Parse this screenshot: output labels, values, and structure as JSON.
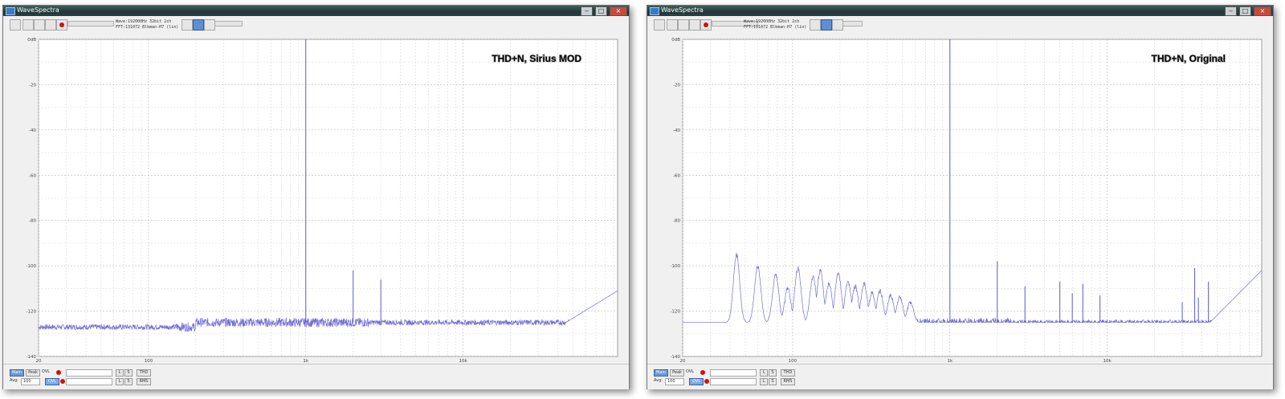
{
  "windows": [
    {
      "title": "WaveSpectra",
      "info_line1": "Wave:192000Hz 32bit 2ch",
      "info_line2": "FFT:131072 Blkman-H7 (lin)",
      "annotation": "THD+N, Sirius MOD",
      "y_ticks": [
        "0dB",
        "-20",
        "-40",
        "-60",
        "-80",
        "-100",
        "-120",
        "-140"
      ],
      "x_ticks": [
        "20",
        "100",
        "1k",
        "10k"
      ],
      "bottom": {
        "main": "Main",
        "peak": "Peak",
        "ovl_label": "OVL",
        "ovl_button": "OVL",
        "avg_label": "Avg:",
        "avg_value": "100",
        "l": "L",
        "s1": "S",
        "s2": "S",
        "thd": "THD",
        "rms": "RMS"
      },
      "spectrum": {
        "fundamental_hz": 1000,
        "fundamental_db": 0,
        "noise_floor_db": -125,
        "harmonics": [
          {
            "hz": 2000,
            "db": -102
          },
          {
            "hz": 3000,
            "db": -106
          }
        ],
        "hf_rise": {
          "from_hz": 45000,
          "to_db": -111
        },
        "hump_peaks": []
      }
    },
    {
      "title": "WaveSpectra",
      "info_line1": "Wave:192000Hz 32bit 2ch",
      "info_line2": "FFT:131072 Blkman-H7 (lin)",
      "annotation": "THD+N, Original",
      "y_ticks": [
        "0dB",
        "-20",
        "-40",
        "-60",
        "-80",
        "-100",
        "-120",
        "-140"
      ],
      "x_ticks": [
        "20",
        "100",
        "1k",
        "10k"
      ],
      "bottom": {
        "main": "Main",
        "peak": "Peak",
        "ovl_label": "OVL",
        "ovl_button": "OVL",
        "avg_label": "Avg:",
        "avg_value": "100",
        "l": "L",
        "s1": "S",
        "s2": "S",
        "thd": "THD",
        "rms": "RMS"
      },
      "spectrum": {
        "fundamental_hz": 1000,
        "fundamental_db": 0,
        "noise_floor_db": -125,
        "harmonics": [
          {
            "hz": 2000,
            "db": -98
          },
          {
            "hz": 3000,
            "db": -109
          },
          {
            "hz": 5000,
            "db": -107
          },
          {
            "hz": 6000,
            "db": -112
          },
          {
            "hz": 7000,
            "db": -108
          },
          {
            "hz": 9000,
            "db": -113
          },
          {
            "hz": 30000,
            "db": -116
          },
          {
            "hz": 36000,
            "db": -101
          },
          {
            "hz": 38000,
            "db": -114
          },
          {
            "hz": 44000,
            "db": -107
          }
        ],
        "hf_rise": {
          "from_hz": 45000,
          "to_db": -102
        },
        "hump_peaks": [
          {
            "hz": 44,
            "db": -95
          },
          {
            "hz": 60,
            "db": -100
          },
          {
            "hz": 78,
            "db": -104
          },
          {
            "hz": 93,
            "db": -110
          },
          {
            "hz": 108,
            "db": -101
          },
          {
            "hz": 135,
            "db": -105
          },
          {
            "hz": 150,
            "db": -102
          },
          {
            "hz": 170,
            "db": -108
          },
          {
            "hz": 195,
            "db": -103
          },
          {
            "hz": 225,
            "db": -107
          },
          {
            "hz": 250,
            "db": -109
          },
          {
            "hz": 285,
            "db": -108
          },
          {
            "hz": 320,
            "db": -112
          },
          {
            "hz": 360,
            "db": -111
          },
          {
            "hz": 420,
            "db": -113
          },
          {
            "hz": 480,
            "db": -114
          },
          {
            "hz": 560,
            "db": -116
          }
        ]
      }
    }
  ]
}
